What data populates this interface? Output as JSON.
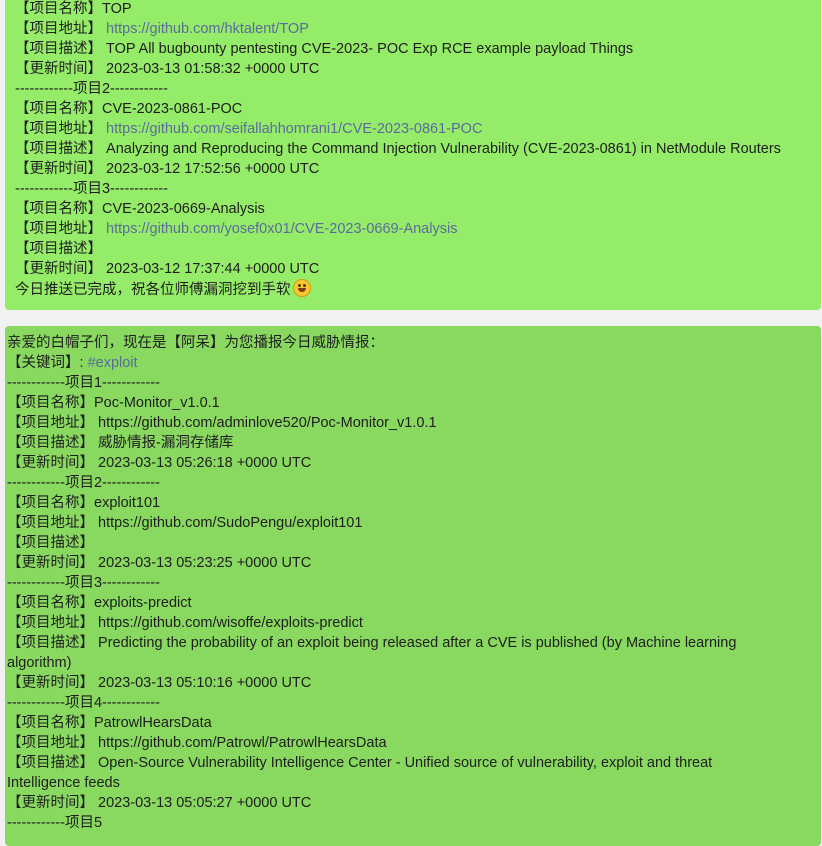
{
  "msg1": {
    "lines": [
      {
        "k": "【项目名称】",
        "v": "TOP"
      },
      {
        "k": "【项目地址】 ",
        "link": "https://github.com/hktalent/TOP"
      },
      {
        "k": "【项目描述】 ",
        "v": "TOP All bugbounty pentesting CVE-2023- POC Exp  RCE example payload  Things"
      },
      {
        "k": "【更新时间】 ",
        "v": "2023-03-13 01:58:32 +0000 UTC"
      },
      {
        "v": " ------------项目2------------"
      },
      {
        "k": "【项目名称】",
        "v": "CVE-2023-0861-POC"
      },
      {
        "k": "【项目地址】 ",
        "link": "https://github.com/seifallahhomrani1/CVE-2023-0861-POC"
      },
      {
        "k": "【项目描述】 ",
        "v": "Analyzing and Reproducing the Command Injection Vulnerability (CVE-2023-0861) in NetModule Routers"
      },
      {
        "k": "【更新时间】 ",
        "v": "2023-03-12 17:52:56 +0000 UTC"
      },
      {
        "v": " ------------项目3------------"
      },
      {
        "k": "【项目名称】",
        "v": "CVE-2023-0669-Analysis"
      },
      {
        "k": "【项目地址】 ",
        "link": "https://github.com/yosef0x01/CVE-2023-0669-Analysis"
      },
      {
        "k": "【项目描述】",
        "v": ""
      },
      {
        "k": "【更新时间】 ",
        "v": "2023-03-12 17:37:44 +0000 UTC"
      }
    ],
    "closing": " 今日推送已完成，祝各位师傅漏洞挖到手软",
    "closing_emoji": "grinning-face-icon",
    "bubble_color": "#95ec69"
  },
  "msg2": {
    "intro": "亲爱的白帽子们，现在是【阿呆】为您播报今日威胁情报：",
    "keyword_label": "【关键词】: ",
    "keyword": "#exploit",
    "projects": [
      {
        "sep": "------------项目1------------",
        "name": "Poc-Monitor_v1.0.1",
        "url": "https://github.com/adminlove520/Poc-Monitor_v1.0.1",
        "desc": "威胁情报-漏洞存储库",
        "time": "2023-03-13 05:26:18 +0000 UTC"
      },
      {
        "sep": "------------项目2------------",
        "name": "exploit101",
        "url": "https://github.com/SudoPengu/exploit101",
        "desc": "",
        "time": "2023-03-13 05:23:25 +0000 UTC"
      },
      {
        "sep": "------------项目3------------",
        "name": "exploits-predict",
        "url": "https://github.com/wisoffe/exploits-predict",
        "desc": "Predicting the probability of an exploit being released after a CVE is published (by Machine learning algorithm)",
        "time": "2023-03-13 05:10:16 +0000 UTC"
      },
      {
        "sep": "------------项目4------------",
        "name": "PatrowlHearsData",
        "url": "https://github.com/Patrowl/PatrowlHearsData",
        "desc": "Open-Source Vulnerability Intelligence Center - Unified source of vulnerability, exploit and threat Intelligence feeds",
        "time": "2023-03-13 05:05:27 +0000 UTC"
      }
    ],
    "trailing": "------------项目5",
    "labels": {
      "name": "【项目名称】",
      "url": "【项目地址】 ",
      "desc": "【项目描述】 ",
      "time": "【更新时间】 "
    },
    "bubble_color": "#89d961"
  }
}
